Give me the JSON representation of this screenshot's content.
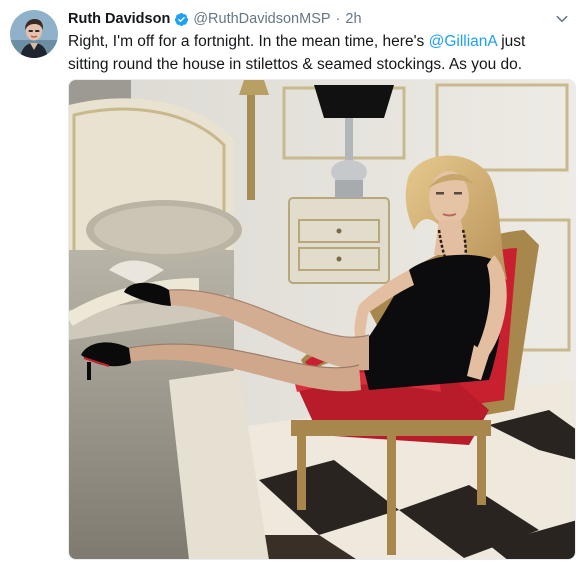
{
  "tweet": {
    "author": {
      "name": "Ruth Davidson",
      "handle": "@RuthDavidsonMSP",
      "verified_icon": "verified-badge-icon"
    },
    "separator": "·",
    "time": "2h",
    "text": {
      "part1": "Right, I'm off for a fortnight. In the mean time, here's ",
      "mention": "@GillianA",
      "part2": " just sitting round the house in stilettos & seamed stockings. As you do."
    },
    "colors": {
      "link": "#1da1f2",
      "verified": "#1da1f2",
      "secondary_text": "#657786"
    }
  }
}
